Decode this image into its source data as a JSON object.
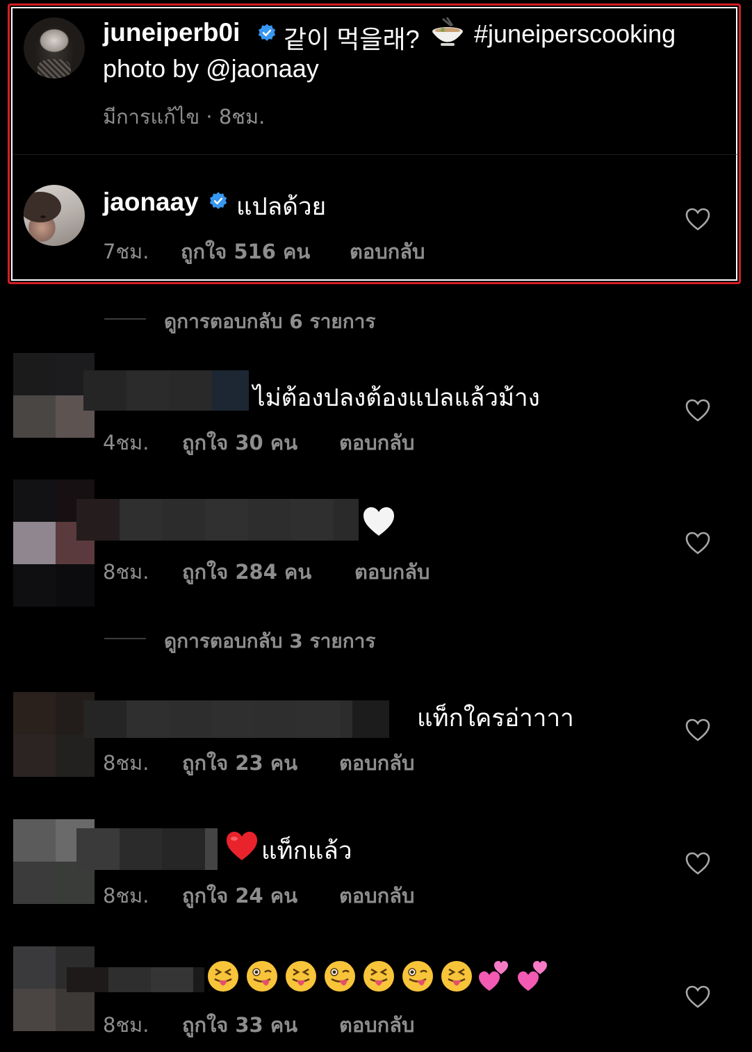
{
  "post": {
    "author": "juneiperb0i",
    "caption_korean": "같이 먹을래?",
    "caption_hashtag": "#juneiperscooking",
    "caption_line2": "photo by @jaonaay",
    "meta": "มีการแก้ไข · 8ชม."
  },
  "top_comment": {
    "author": "jaonaay",
    "text": "แปลด้วย",
    "time": "7ชม.",
    "likes": "ถูกใจ 516 คน",
    "reply": "ตอบกลับ"
  },
  "view_replies_1": "ดูการตอบกลับ 6 รายการ",
  "view_replies_2": "ดูการตอบกลับ 3 รายการ",
  "comments": [
    {
      "text": "ไม่ต้องปลงต้องแปลแล้วม้าง",
      "time": "4ชม.",
      "likes": "ถูกใจ 30 คน",
      "reply": "ตอบกลับ"
    },
    {
      "text": "🤍",
      "time": "8ชม.",
      "likes": "ถูกใจ 284 คน",
      "reply": "ตอบกลับ"
    },
    {
      "text": "แท็กใครอ่าาาา",
      "time": "8ชม.",
      "likes": "ถูกใจ 23 คน",
      "reply": "ตอบกลับ"
    },
    {
      "text": "แท็กแล้ว",
      "time": "8ชม.",
      "likes": "ถูกใจ 24 คน",
      "reply": "ตอบกลับ"
    },
    {
      "text": "😝😜😝😜😝😜😝💕💕",
      "time": "8ชม.",
      "likes": "ถูกใจ 33 คน",
      "reply": "ตอบกลับ"
    }
  ],
  "colors": {
    "highlight_border": "#d41f26",
    "verified_blue": "#3897f0",
    "meta_gray": "#8e8e8e"
  }
}
